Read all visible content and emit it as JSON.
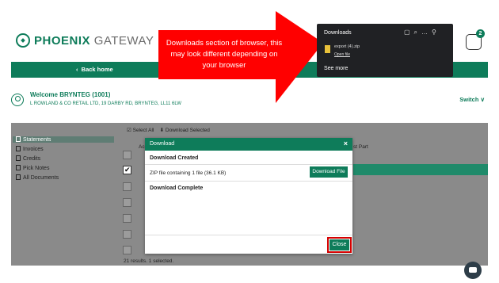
{
  "brand": {
    "name_bold": "PHOENIX",
    "name_light": "GATEWAY"
  },
  "header": {
    "basket_count": "2"
  },
  "nav": {
    "back_home": "Back home"
  },
  "welcome": {
    "title": "Welcome BRYNTEG (1001)",
    "address": "L ROWLAND & CO RETAIL LTD, 19 DARBY RD, BRYNTEG, LL11 6LW",
    "switch_label": "Switch"
  },
  "sidebar": {
    "items": [
      {
        "label": "Statements",
        "active": true
      },
      {
        "label": "Invoices"
      },
      {
        "label": "Credits"
      },
      {
        "label": "Pick Notes"
      },
      {
        "label": "All Documents"
      }
    ]
  },
  "toolbar": {
    "select_all": "Select All",
    "download_selected": "Download Selected"
  },
  "table": {
    "col_partial": "Ac",
    "col_right_partial": "st Part",
    "results": "21 results. 1 selected."
  },
  "modal": {
    "title": "Download",
    "close_glyph": "×",
    "created": "Download Created",
    "zip_text": "ZIP file containing 1 file (36.1 KB)",
    "download_file_label": "Download File",
    "complete": "Download Complete",
    "close_label": "Close"
  },
  "annotation": {
    "text": "Downloads section of browser, this may look different depending on your browser",
    "color": "#ff0000"
  },
  "browser_downloads": {
    "title": "Downloads",
    "file_name": "export (4).zip",
    "open_link": "Open file",
    "see_more": "See more"
  },
  "colors": {
    "brand_green": "#0e7c5a",
    "highlight_red": "#d40000"
  }
}
